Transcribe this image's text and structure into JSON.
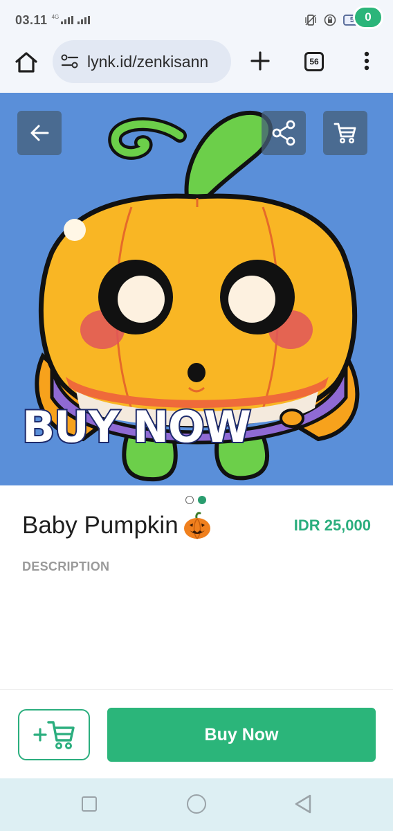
{
  "status_bar": {
    "time": "03.11",
    "network": "4G",
    "battery": "52"
  },
  "browser": {
    "url": "lynk.id/zenkisann",
    "tab_count": "56"
  },
  "product": {
    "image_overlay_text": "BUY NOW",
    "title": "Baby Pumpkin",
    "price": "IDR 25,000",
    "description_label": "DESCRIPTION",
    "image_dots": {
      "total": 2,
      "active_index": 1
    }
  },
  "cart": {
    "count": "0"
  },
  "actions": {
    "add_to_cart_icon": "add-cart-icon",
    "buy_label": "Buy Now"
  },
  "colors": {
    "accent": "#2bb57a",
    "hero_background": "#5a8fd9",
    "price": "#2bae7e"
  },
  "icons": [
    "home-icon",
    "site-settings-icon",
    "plus-icon",
    "more-icon",
    "back-arrow-icon",
    "share-icon",
    "cart-icon",
    "pumpkin-emoji-icon"
  ]
}
